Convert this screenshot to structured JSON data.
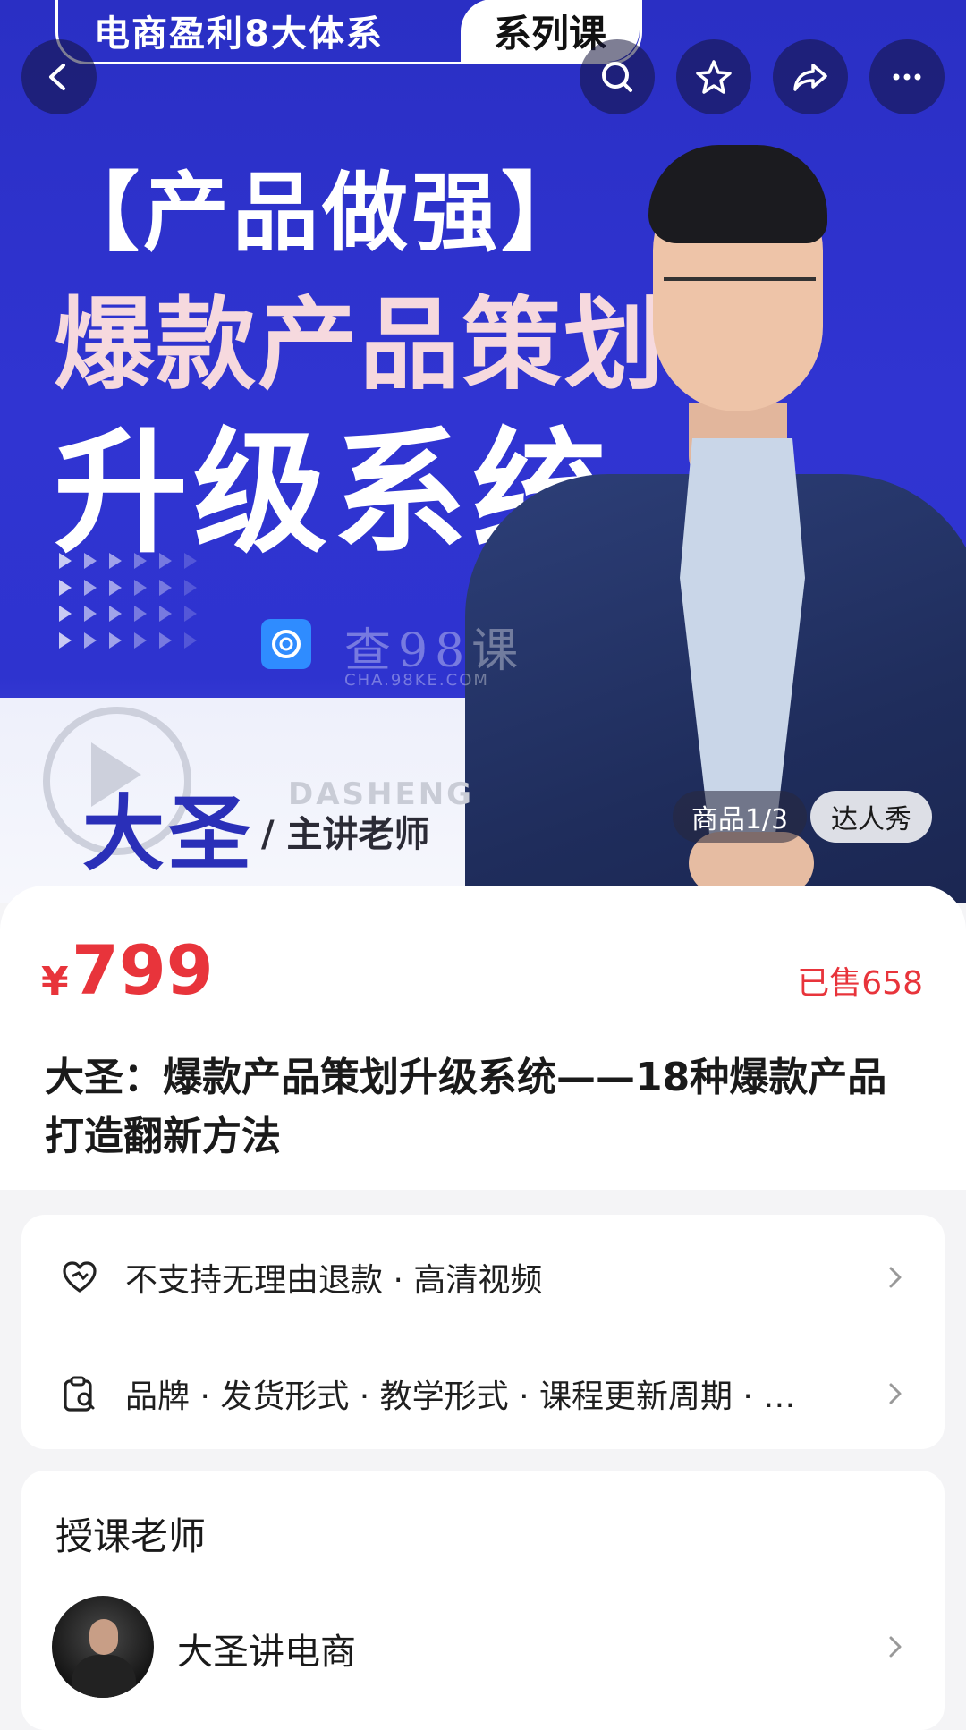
{
  "banner": {
    "series_left": "电商盈利8大体系",
    "series_right": "系列课",
    "line1": "【产品做强】",
    "line2": "爆款产品策划",
    "line3": "升级系统",
    "watermark": "查98课",
    "watermark_sub": "CHA.98KE.COM",
    "teacher_name": "大圣",
    "teacher_en": "DASHENG",
    "teacher_role": "/ 主讲老师"
  },
  "nav": {
    "icons": [
      "back-icon",
      "search-icon",
      "star-icon",
      "share-icon",
      "more-icon"
    ]
  },
  "badges": {
    "gallery_counter": "商品1/3",
    "showcase": "达人秀"
  },
  "product": {
    "currency": "¥",
    "price": "799",
    "sold": "已售658",
    "title": "大圣：爆款产品策划升级系统——18种爆款产品打造翻新方法"
  },
  "info_rows": [
    {
      "icon": "heart-shield-icon",
      "text": "不支持无理由退款 · 高清视频"
    },
    {
      "icon": "clipboard-search-icon",
      "text": "品牌 · 发货形式 · 教学形式 · 课程更新周期 · …"
    }
  ],
  "teacher_section": {
    "title": "授课老师",
    "name": "大圣讲电商"
  },
  "colors": {
    "banner_blue": "#2e33cf",
    "price_red": "#e8343b"
  }
}
